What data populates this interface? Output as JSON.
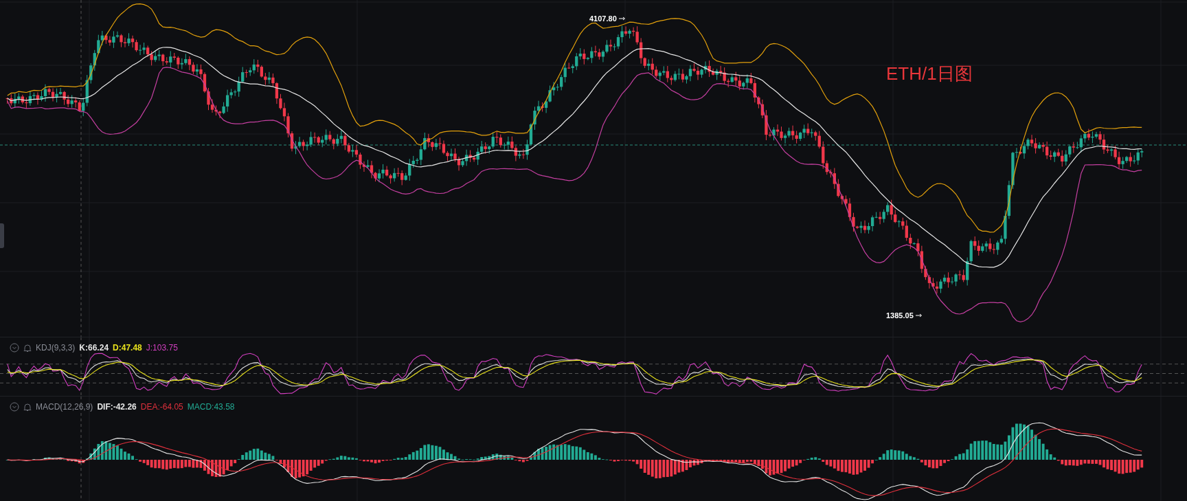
{
  "main_chart": {
    "title": "ETH/1日图",
    "high_marker": "4107.80",
    "low_marker": "1385.05"
  },
  "kdj": {
    "name": "KDJ(9,3,3)",
    "k": "K:66.24",
    "d": "D:47.48",
    "j": "J:103.75"
  },
  "macd": {
    "name": "MACD(12,26,9)",
    "dif": "DIF:-42.26",
    "dea": "DEA:-64.05",
    "macd": "MACD:43.58"
  }
}
